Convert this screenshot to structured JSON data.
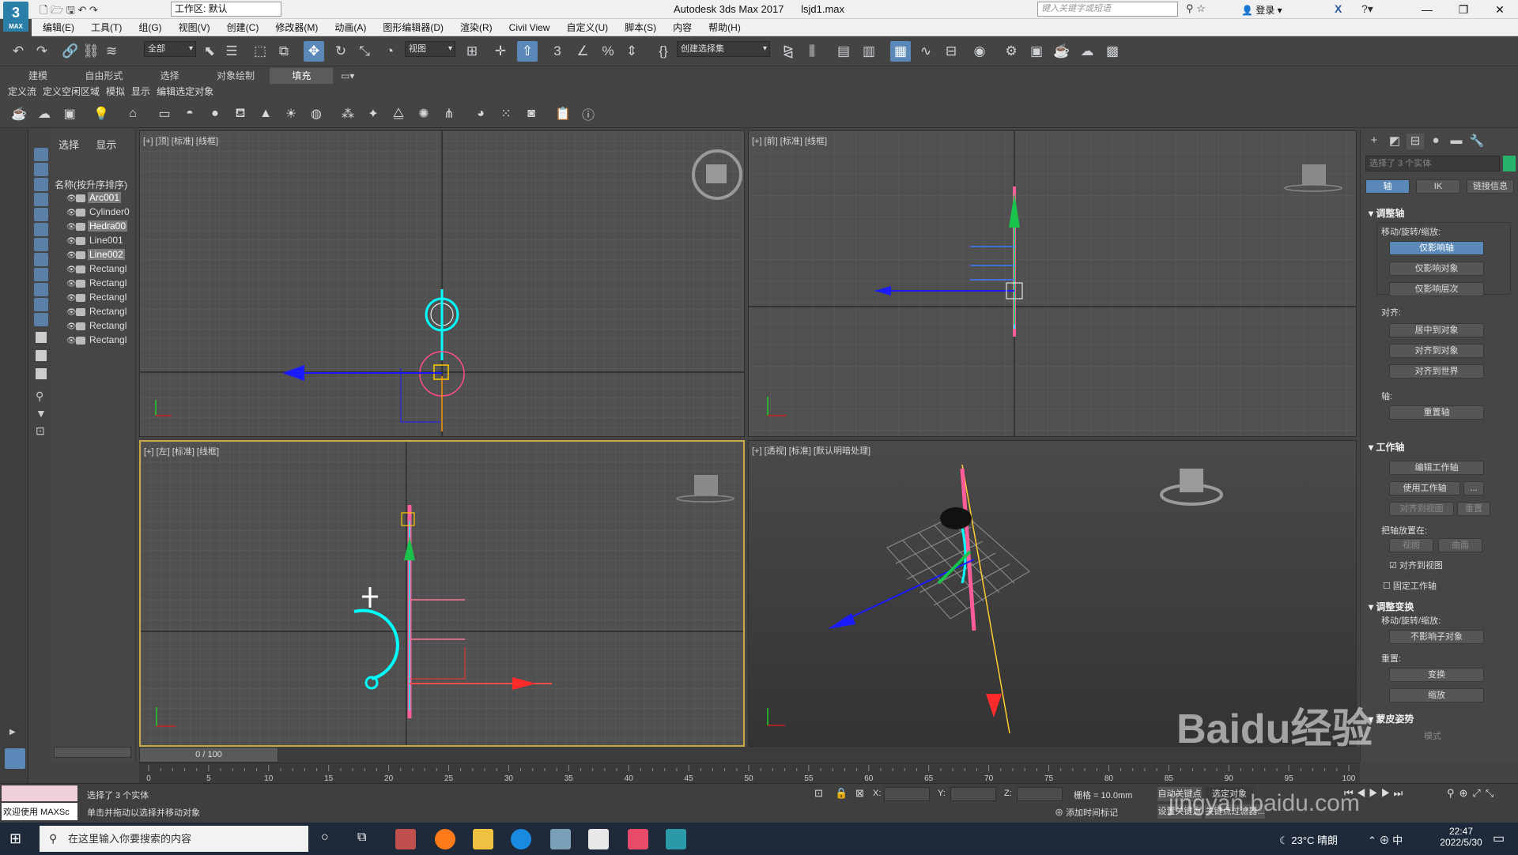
{
  "app": {
    "title": "Autodesk 3ds Max 2017",
    "file": "lsjd1.max",
    "logo_main": "3",
    "logo_sub": "MAX",
    "workspace": "工作区: 默认",
    "search_placeholder": "键入关键字或短语",
    "login": "登录"
  },
  "menu": [
    "编辑(E)",
    "工具(T)",
    "组(G)",
    "视图(V)",
    "创建(C)",
    "修改器(M)",
    "动画(A)",
    "图形编辑器(D)",
    "渲染(R)",
    "Civil View",
    "自定义(U)",
    "脚本(S)",
    "内容",
    "帮助(H)"
  ],
  "toolbar": {
    "filter": "全部",
    "coord": "视图",
    "selset": "创建选择集"
  },
  "ribbon": {
    "tabs": [
      "建模",
      "自由形式",
      "选择",
      "对象绘制",
      "填充"
    ],
    "selected_tab": "填充",
    "sub": [
      "定义流",
      "定义空闲区域",
      "模拟",
      "显示",
      "编辑选定对象"
    ]
  },
  "explorer": {
    "tabs": [
      "选择",
      "显示"
    ],
    "header": "名称(按升序排序)",
    "objects": [
      {
        "name": "Arc001",
        "selected": true
      },
      {
        "name": "Cylinder0",
        "selected": false
      },
      {
        "name": "Hedra00",
        "selected": true
      },
      {
        "name": "Line001",
        "selected": false
      },
      {
        "name": "Line002",
        "selected": true
      },
      {
        "name": "Rectangl",
        "selected": false
      },
      {
        "name": "Rectangl",
        "selected": false
      },
      {
        "name": "Rectangl",
        "selected": false
      },
      {
        "name": "Rectangl",
        "selected": false
      },
      {
        "name": "Rectangl",
        "selected": false
      },
      {
        "name": "Rectangl",
        "selected": false
      }
    ]
  },
  "viewports": {
    "top": "[+] [顶] [标准] [线框]",
    "front": "[+] [前] [标准] [线框]",
    "left": "[+] [左] [标准] [线框]",
    "persp": "[+] [透视] [标准] [默认明暗处理]"
  },
  "cmdpanel": {
    "selection": "选择了 3 个实体",
    "swatch_color": "#27b36a",
    "tabs3": [
      "轴",
      "IK",
      "链接信息"
    ],
    "rollout_adjust_pivot": "调整轴",
    "move_rot_scale": "移动/旋转/缩放:",
    "btn_affect_pivot": "仅影响轴",
    "btn_affect_obj": "仅影响对象",
    "btn_affect_hier": "仅影响层次",
    "align": "对齐:",
    "btn_center": "居中到对象",
    "btn_align_obj": "对齐到对象",
    "btn_align_world": "对齐到世界",
    "pivot": "轴:",
    "btn_reset_pivot": "重置轴",
    "rollout_working_pivot": "工作轴",
    "btn_edit_wp": "编辑工作轴",
    "btn_use_wp": "使用工作轴",
    "btn_more": "...",
    "btn_align_view": "对齐到视图",
    "btn_reset": "重置",
    "place_pivot": "把轴放置在:",
    "btn_view": "视图",
    "btn_surface": "曲面",
    "chk_align_view": "对齐到视图",
    "chk_fix_wp": "固定工作轴",
    "rollout_adjust_transform": "调整变换",
    "btn_dont_affect_children": "不影响子对象",
    "reset": "重置:",
    "btn_transform": "变换",
    "btn_scale": "缩放",
    "rollout_skin": "蒙皮姿势",
    "skin_mode": "模式"
  },
  "timeline": {
    "frame": "0 / 100",
    "ticks": [
      "0",
      "5",
      "10",
      "15",
      "20",
      "25",
      "30",
      "35",
      "40",
      "45",
      "50",
      "55",
      "60",
      "65",
      "70",
      "75",
      "80",
      "85",
      "90",
      "95",
      "100"
    ]
  },
  "status": {
    "maxscript": "欢迎使用 MAXSc",
    "line1": "选择了 3 个实体",
    "line2": "单击并拖动以选择并移动对象",
    "x": "X:",
    "y": "Y:",
    "z": "Z:",
    "grid": "栅格 = 10.0mm",
    "add_time_tag": "添加时间标记",
    "autokey": "自动关键点",
    "selected_obj": "选定对象",
    "setkey": "设置关键点",
    "key_filter": "关键点过滤器..."
  },
  "taskbar": {
    "search": "在这里输入你要搜索的内容",
    "weather": "23°C 晴朗",
    "ime": "中",
    "time": "22:47",
    "date": "2022/5/30"
  },
  "watermark": "jingyan.baidu.com",
  "watermark_cn": "Baidu经验"
}
